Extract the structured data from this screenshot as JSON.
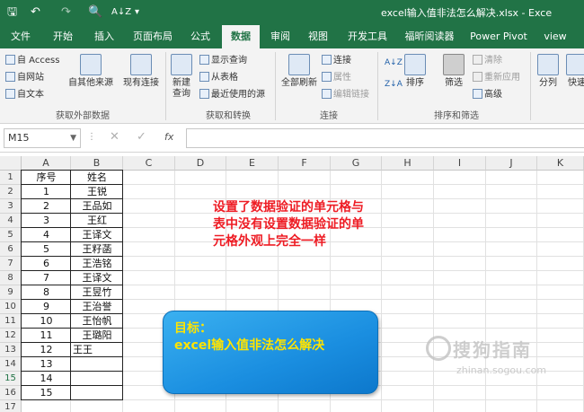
{
  "titlebar": {
    "title": "excel输入值非法怎么解决.xlsx - Exce",
    "save_glyph": "🖫",
    "undo_glyph": "↶",
    "redo_glyph": "↷",
    "print_preview_glyph": "🔍",
    "sort_glyph": "A↓Z",
    "customize_glyph": "▾"
  },
  "tabs": [
    "文件",
    "开始",
    "插入",
    "页面布局",
    "公式",
    "数据",
    "审阅",
    "视图",
    "开发工具",
    "福昕阅读器",
    "Power Pivot",
    "view"
  ],
  "active_tab": "数据",
  "ribbon": {
    "get_external_data": {
      "access": "自 Access",
      "web": "自网站",
      "text": "自文本",
      "other_sources": "自其他来源",
      "existing_connections": "现有连接",
      "group_label": "获取外部数据"
    },
    "get_transform": {
      "new_query_line1": "新建",
      "new_query_line2": "查询",
      "show_queries": "显示查询",
      "from_table": "从表格",
      "recent_sources": "最近使用的源",
      "group_label": "获取和转换"
    },
    "connections": {
      "refresh_all": "全部刷新",
      "connections": "连接",
      "properties": "属性",
      "edit_links": "编辑链接",
      "group_label": "连接"
    },
    "sort_filter": {
      "sort": "排序",
      "filter": "筛选",
      "clear": "清除",
      "reapply": "重新应用",
      "advanced": "高级",
      "group_label": "排序和筛选"
    },
    "data_tools": {
      "text_to_columns": "分列",
      "flash_fill": "快速"
    }
  },
  "formula_bar": {
    "name_box": "M15",
    "cancel_glyph": "✕",
    "enter_glyph": "✓",
    "fx": "fx",
    "formula": ""
  },
  "sheet": {
    "columns": [
      "A",
      "B",
      "C",
      "D",
      "E",
      "F",
      "G",
      "H",
      "I",
      "J",
      "K"
    ],
    "rows": [
      "1",
      "2",
      "3",
      "4",
      "5",
      "6",
      "7",
      "8",
      "9",
      "10",
      "11",
      "12",
      "13",
      "14",
      "15",
      "16",
      "17"
    ],
    "selected_row": "15",
    "header": [
      "序号",
      "姓名"
    ],
    "data": [
      [
        "1",
        "王锐"
      ],
      [
        "2",
        "王品如"
      ],
      [
        "3",
        "王红"
      ],
      [
        "4",
        "王译文"
      ],
      [
        "5",
        "王籽菡"
      ],
      [
        "6",
        "王浩铭"
      ],
      [
        "7",
        "王译文"
      ],
      [
        "8",
        "王昱竹"
      ],
      [
        "9",
        "王治誉"
      ],
      [
        "10",
        "王怡帆"
      ],
      [
        "11",
        "王璐阳"
      ],
      [
        "12",
        "王王"
      ],
      [
        "13",
        ""
      ],
      [
        "14",
        ""
      ],
      [
        "15",
        ""
      ]
    ]
  },
  "annotation": {
    "line1": "设置了数据验证的单元格与",
    "line2": "表中没有设置数据验证的单",
    "line3": "元格外观上完全一样"
  },
  "goal_box": {
    "line1": "目标：",
    "line2": "excel输入值非法怎么解决"
  },
  "watermark": {
    "line1": "搜狗指南",
    "line2": "zhinan.sogou.com"
  },
  "colors": {
    "excel_green": "#217346",
    "annotation_red": "#ee1c24",
    "goal_text": "#ffe400",
    "goal_bg": "#1a8ee0"
  }
}
